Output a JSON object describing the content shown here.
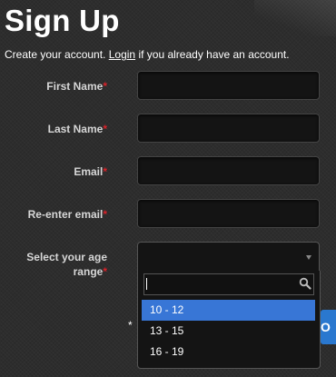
{
  "header": {
    "title": "Sign Up",
    "subtitle_prefix": "Create your account. ",
    "login_link": "Login",
    "subtitle_suffix": " if you already have an account."
  },
  "form": {
    "required_mark": "*",
    "fields": [
      {
        "label": "First Name",
        "value": ""
      },
      {
        "label": "Last Name",
        "value": ""
      },
      {
        "label": "Email",
        "value": ""
      },
      {
        "label": "Re-enter email",
        "value": ""
      }
    ],
    "age": {
      "label_line1": "Select your age",
      "label_line2": "range",
      "selected_value": "",
      "search_value": "",
      "options": [
        "10 - 12",
        "13 - 15",
        "16 - 19"
      ],
      "highlighted_option": "10 - 12"
    }
  },
  "footer": {
    "note_prefix": "* ",
    "next_button_label_visible": "O"
  },
  "colors": {
    "required": "#d8232a",
    "highlight": "#3876d6",
    "button": "#2a78cf"
  },
  "icons": {
    "search": "search-icon",
    "dropdown": "chevron-down-icon"
  }
}
